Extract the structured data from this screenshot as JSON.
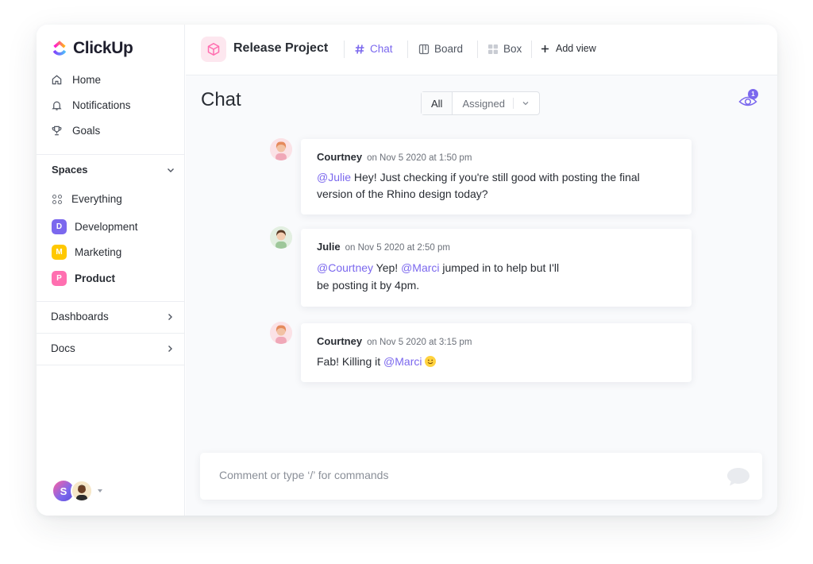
{
  "app": {
    "name": "ClickUp"
  },
  "sidebar": {
    "nav": [
      {
        "label": "Home"
      },
      {
        "label": "Notifications"
      },
      {
        "label": "Goals"
      }
    ],
    "spaces_header": "Spaces",
    "spaces": [
      {
        "label": "Everything"
      },
      {
        "label": "Development",
        "letter": "D",
        "color": "#7b68ee"
      },
      {
        "label": "Marketing",
        "letter": "M",
        "color": "#ffc800"
      },
      {
        "label": "Product",
        "letter": "P",
        "color": "#ff6fb0"
      }
    ],
    "links": [
      {
        "label": "Dashboards"
      },
      {
        "label": "Docs"
      }
    ],
    "user_initial": "S"
  },
  "topbar": {
    "project_title": "Release Project",
    "tabs": [
      {
        "label": "Chat",
        "icon": "hash-icon",
        "active": true
      },
      {
        "label": "Board",
        "icon": "board-icon",
        "active": false
      },
      {
        "label": "Box",
        "icon": "box-grid-icon",
        "active": false
      }
    ],
    "add_view": "Add view"
  },
  "chat": {
    "title": "Chat",
    "filter": {
      "all": "All",
      "assigned": "Assigned"
    },
    "watchers_count": "1",
    "messages": [
      {
        "author": "Courtney",
        "time": "on Nov 5 2020 at 1:50 pm",
        "mention1": "@Julie",
        "text1": " Hey! Just checking if you're still good with posting the final version of the Rhino design today?"
      },
      {
        "author": "Julie",
        "time": "on Nov 5 2020 at 2:50 pm",
        "mention1": "@Courtney",
        "text1": " Yep! ",
        "mention2": "@Marci",
        "text2": " jumped in to help but I'll",
        "text3": "be posting it by 4pm."
      },
      {
        "author": "Courtney",
        "time": "on Nov 5 2020 at 3:15 pm",
        "text1": "Fab! Killing it ",
        "mention1": "@Marci"
      }
    ],
    "composer_placeholder": "Comment or type ‘/’ for commands"
  },
  "colors": {
    "accent": "#7b68ee"
  }
}
